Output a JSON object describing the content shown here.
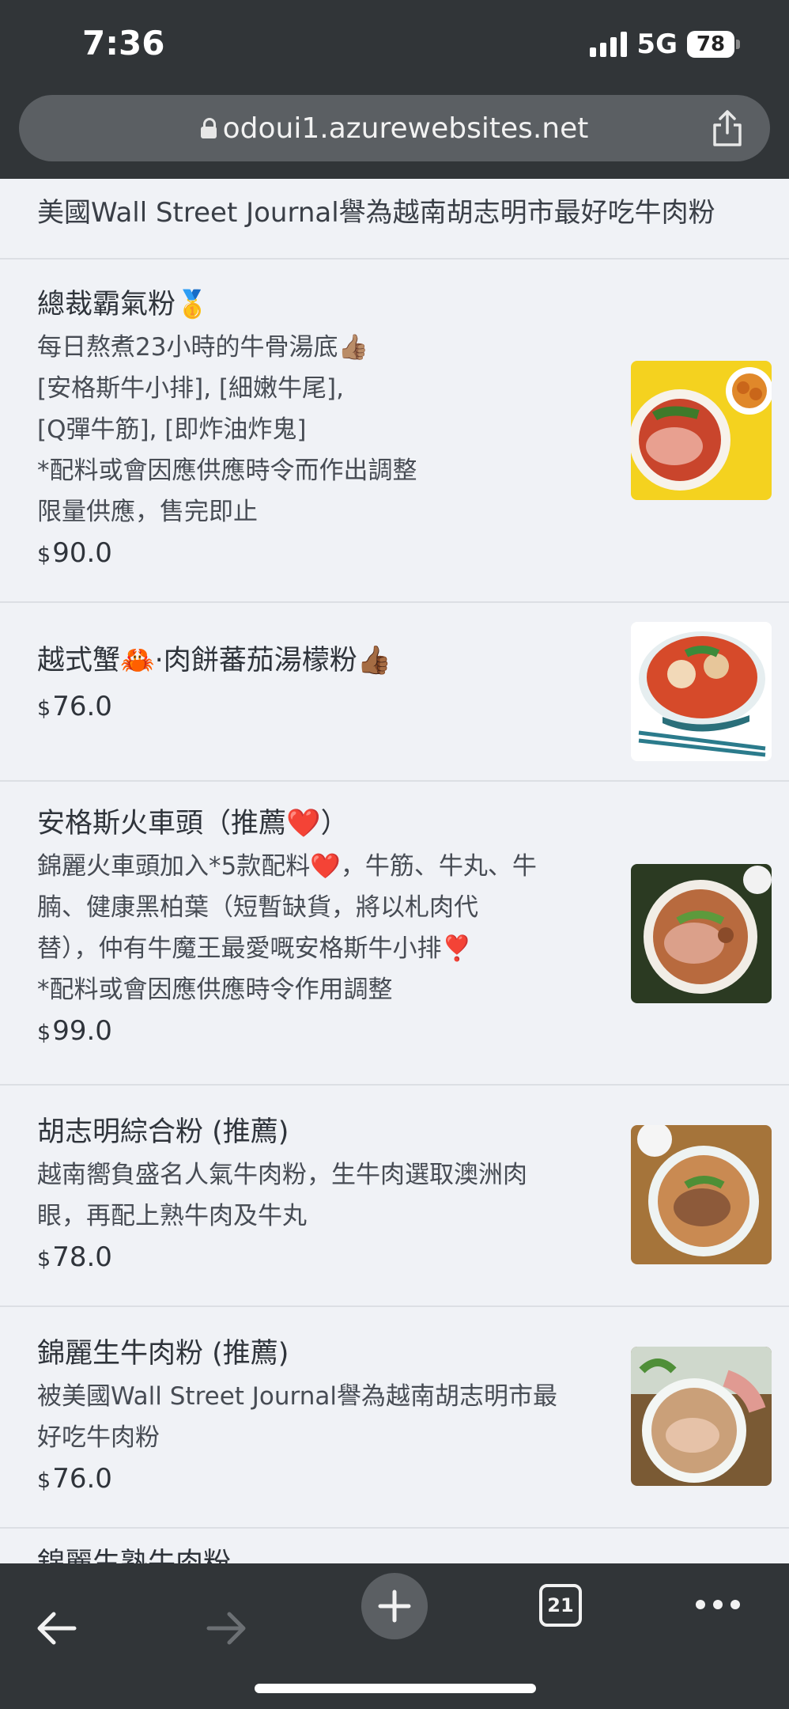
{
  "status_bar": {
    "time": "7:36",
    "network": "5G",
    "battery": "78"
  },
  "browser": {
    "url": "odoui1.azurewebsites.net",
    "tab_count": "21"
  },
  "menu": {
    "intro": "美國Wall Street Journal譽為越南胡志明市最好吃牛肉粉",
    "currency": "$",
    "items": [
      {
        "title": "總裁霸氣粉",
        "title_emoji": "🥇",
        "description": "每日熬煮23小時的牛骨湯底👍🏽\n [安格斯牛小排], [細嫩牛尾],\n [Q彈牛筋], [即炸油炸鬼]\n *配料或會因應供應時令而作出調整\n 限量供應，售完即止",
        "price": "90.0"
      },
      {
        "title": "越式蟹🦀·肉餅蕃茄湯檬粉👍🏾",
        "title_emoji": "",
        "description": "",
        "price": "76.0"
      },
      {
        "title": "安格斯火車頭（推薦❤️）",
        "title_emoji": "",
        "description": "錦麗火車頭加入*5款配料❤️，牛筋、牛丸、牛\n腩、健康黑柏葉（短暫缺貨，將以札肉代\n替），仲有牛魔王最愛嘅安格斯牛小排❣️\n*配料或會因應供應時令作用調整",
        "price": "99.0"
      },
      {
        "title": "胡志明綜合粉 (推薦)",
        "title_emoji": "",
        "description": "越南嚮負盛名人氣牛肉粉，生牛肉選取澳洲肉\n眼，再配上熟牛肉及牛丸",
        "price": "78.0"
      },
      {
        "title": "錦麗生牛肉粉 (推薦)",
        "title_emoji": "",
        "description": "被美國Wall Street Journal譽為越南胡志明市最\n好吃牛肉粉",
        "price": "76.0"
      }
    ],
    "partial_next_title": "錦麗生熟牛肉粉"
  },
  "icons": {
    "back": "back-arrow-icon",
    "forward": "forward-arrow-icon",
    "new_tab": "plus-icon",
    "tabs": "tabs-icon",
    "more": "more-icon",
    "share": "share-icon",
    "lock": "lock-icon"
  },
  "colors": {
    "chrome": "#313538",
    "url_bar": "#5b5f63",
    "page_bg": "#f0f2f6",
    "divider": "#dcdfe4"
  }
}
